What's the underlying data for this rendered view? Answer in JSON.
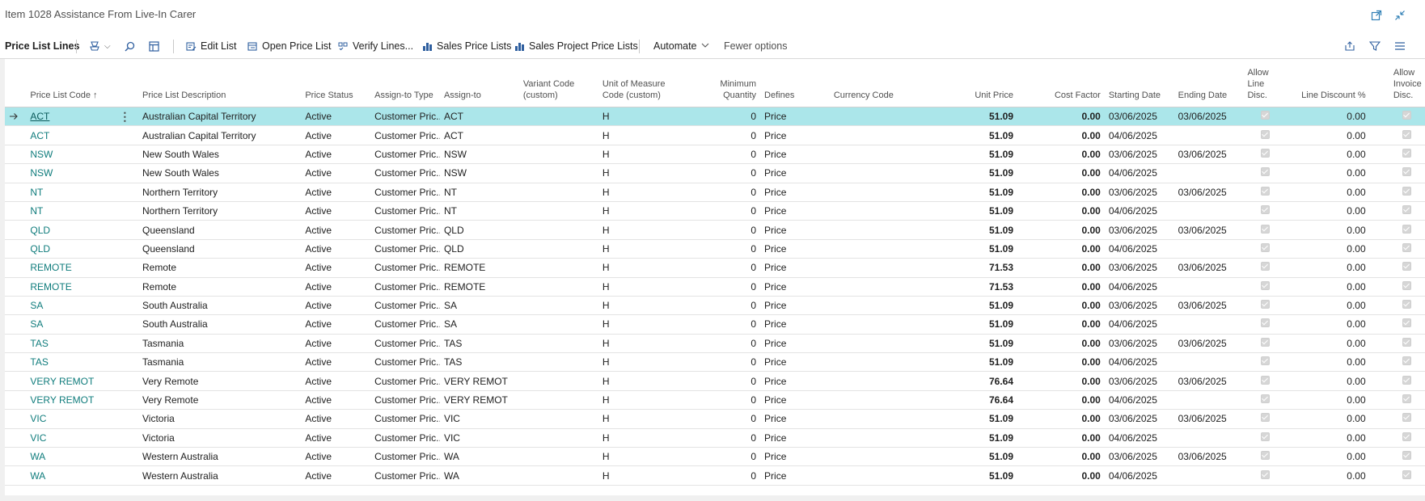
{
  "window": {
    "title": "Item 1028 Assistance From Live-In Carer"
  },
  "actionbar": {
    "section_title": "Price List Lines",
    "edit_list": "Edit List",
    "open_price_list": "Open Price List",
    "verify_lines": "Verify Lines...",
    "sales_price_lists": "Sales Price Lists",
    "sales_project_price_lists": "Sales Project Price Lists",
    "automate": "Automate",
    "fewer_options": "Fewer options"
  },
  "columns": {
    "price_list_code": "Price List Code",
    "sort_indicator": "↑",
    "price_list_description": "Price List Description",
    "price_status": "Price Status",
    "assign_to_type": "Assign-to Type",
    "assign_to": "Assign-to",
    "variant_code": "Variant Code (custom)",
    "unit_of_measure": "Unit of Measure Code (custom)",
    "minimum_quantity": "Minimum Quantity",
    "defines": "Defines",
    "currency_code": "Currency Code",
    "unit_price": "Unit Price",
    "cost_factor": "Cost Factor",
    "starting_date": "Starting Date",
    "ending_date": "Ending Date",
    "allow_line_disc": "Allow Line Disc.",
    "line_discount": "Line Discount %",
    "allow_invoice_disc": "Allow Invoice Disc."
  },
  "rows": [
    {
      "code": "ACT",
      "desc": "Australian Capital Territory",
      "status": "Active",
      "type": "Customer Pric...",
      "assign": "ACT",
      "variant": "",
      "uom": "H",
      "minqty": "0",
      "defines": "Price",
      "currency": "",
      "price": "51.09",
      "cost": "0.00",
      "start": "03/06/2025",
      "end": "03/06/2025",
      "linedisc": "0.00"
    },
    {
      "code": "ACT",
      "desc": "Australian Capital Territory",
      "status": "Active",
      "type": "Customer Pric...",
      "assign": "ACT",
      "variant": "",
      "uom": "H",
      "minqty": "0",
      "defines": "Price",
      "currency": "",
      "price": "51.09",
      "cost": "0.00",
      "start": "04/06/2025",
      "end": "",
      "linedisc": "0.00"
    },
    {
      "code": "NSW",
      "desc": "New South Wales",
      "status": "Active",
      "type": "Customer Pric...",
      "assign": "NSW",
      "variant": "",
      "uom": "H",
      "minqty": "0",
      "defines": "Price",
      "currency": "",
      "price": "51.09",
      "cost": "0.00",
      "start": "03/06/2025",
      "end": "03/06/2025",
      "linedisc": "0.00"
    },
    {
      "code": "NSW",
      "desc": "New South Wales",
      "status": "Active",
      "type": "Customer Pric...",
      "assign": "NSW",
      "variant": "",
      "uom": "H",
      "minqty": "0",
      "defines": "Price",
      "currency": "",
      "price": "51.09",
      "cost": "0.00",
      "start": "04/06/2025",
      "end": "",
      "linedisc": "0.00"
    },
    {
      "code": "NT",
      "desc": "Northern Territory",
      "status": "Active",
      "type": "Customer Pric...",
      "assign": "NT",
      "variant": "",
      "uom": "H",
      "minqty": "0",
      "defines": "Price",
      "currency": "",
      "price": "51.09",
      "cost": "0.00",
      "start": "03/06/2025",
      "end": "03/06/2025",
      "linedisc": "0.00"
    },
    {
      "code": "NT",
      "desc": "Northern Territory",
      "status": "Active",
      "type": "Customer Pric...",
      "assign": "NT",
      "variant": "",
      "uom": "H",
      "minqty": "0",
      "defines": "Price",
      "currency": "",
      "price": "51.09",
      "cost": "0.00",
      "start": "04/06/2025",
      "end": "",
      "linedisc": "0.00"
    },
    {
      "code": "QLD",
      "desc": "Queensland",
      "status": "Active",
      "type": "Customer Pric...",
      "assign": "QLD",
      "variant": "",
      "uom": "H",
      "minqty": "0",
      "defines": "Price",
      "currency": "",
      "price": "51.09",
      "cost": "0.00",
      "start": "03/06/2025",
      "end": "03/06/2025",
      "linedisc": "0.00"
    },
    {
      "code": "QLD",
      "desc": "Queensland",
      "status": "Active",
      "type": "Customer Pric...",
      "assign": "QLD",
      "variant": "",
      "uom": "H",
      "minqty": "0",
      "defines": "Price",
      "currency": "",
      "price": "51.09",
      "cost": "0.00",
      "start": "04/06/2025",
      "end": "",
      "linedisc": "0.00"
    },
    {
      "code": "REMOTE",
      "desc": "Remote",
      "status": "Active",
      "type": "Customer Pric...",
      "assign": "REMOTE",
      "variant": "",
      "uom": "H",
      "minqty": "0",
      "defines": "Price",
      "currency": "",
      "price": "71.53",
      "cost": "0.00",
      "start": "03/06/2025",
      "end": "03/06/2025",
      "linedisc": "0.00"
    },
    {
      "code": "REMOTE",
      "desc": "Remote",
      "status": "Active",
      "type": "Customer Pric...",
      "assign": "REMOTE",
      "variant": "",
      "uom": "H",
      "minqty": "0",
      "defines": "Price",
      "currency": "",
      "price": "71.53",
      "cost": "0.00",
      "start": "04/06/2025",
      "end": "",
      "linedisc": "0.00"
    },
    {
      "code": "SA",
      "desc": "South Australia",
      "status": "Active",
      "type": "Customer Pric...",
      "assign": "SA",
      "variant": "",
      "uom": "H",
      "minqty": "0",
      "defines": "Price",
      "currency": "",
      "price": "51.09",
      "cost": "0.00",
      "start": "03/06/2025",
      "end": "03/06/2025",
      "linedisc": "0.00"
    },
    {
      "code": "SA",
      "desc": "South Australia",
      "status": "Active",
      "type": "Customer Pric...",
      "assign": "SA",
      "variant": "",
      "uom": "H",
      "minqty": "0",
      "defines": "Price",
      "currency": "",
      "price": "51.09",
      "cost": "0.00",
      "start": "04/06/2025",
      "end": "",
      "linedisc": "0.00"
    },
    {
      "code": "TAS",
      "desc": "Tasmania",
      "status": "Active",
      "type": "Customer Pric...",
      "assign": "TAS",
      "variant": "",
      "uom": "H",
      "minqty": "0",
      "defines": "Price",
      "currency": "",
      "price": "51.09",
      "cost": "0.00",
      "start": "03/06/2025",
      "end": "03/06/2025",
      "linedisc": "0.00"
    },
    {
      "code": "TAS",
      "desc": "Tasmania",
      "status": "Active",
      "type": "Customer Pric...",
      "assign": "TAS",
      "variant": "",
      "uom": "H",
      "minqty": "0",
      "defines": "Price",
      "currency": "",
      "price": "51.09",
      "cost": "0.00",
      "start": "04/06/2025",
      "end": "",
      "linedisc": "0.00"
    },
    {
      "code": "VERY REMOT",
      "desc": "Very Remote",
      "status": "Active",
      "type": "Customer Pric...",
      "assign": "VERY REMOT",
      "variant": "",
      "uom": "H",
      "minqty": "0",
      "defines": "Price",
      "currency": "",
      "price": "76.64",
      "cost": "0.00",
      "start": "03/06/2025",
      "end": "03/06/2025",
      "linedisc": "0.00"
    },
    {
      "code": "VERY REMOT",
      "desc": "Very Remote",
      "status": "Active",
      "type": "Customer Pric...",
      "assign": "VERY REMOT",
      "variant": "",
      "uom": "H",
      "minqty": "0",
      "defines": "Price",
      "currency": "",
      "price": "76.64",
      "cost": "0.00",
      "start": "04/06/2025",
      "end": "",
      "linedisc": "0.00"
    },
    {
      "code": "VIC",
      "desc": "Victoria",
      "status": "Active",
      "type": "Customer Pric...",
      "assign": "VIC",
      "variant": "",
      "uom": "H",
      "minqty": "0",
      "defines": "Price",
      "currency": "",
      "price": "51.09",
      "cost": "0.00",
      "start": "03/06/2025",
      "end": "03/06/2025",
      "linedisc": "0.00"
    },
    {
      "code": "VIC",
      "desc": "Victoria",
      "status": "Active",
      "type": "Customer Pric...",
      "assign": "VIC",
      "variant": "",
      "uom": "H",
      "minqty": "0",
      "defines": "Price",
      "currency": "",
      "price": "51.09",
      "cost": "0.00",
      "start": "04/06/2025",
      "end": "",
      "linedisc": "0.00"
    },
    {
      "code": "WA",
      "desc": "Western Australia",
      "status": "Active",
      "type": "Customer Pric...",
      "assign": "WA",
      "variant": "",
      "uom": "H",
      "minqty": "0",
      "defines": "Price",
      "currency": "",
      "price": "51.09",
      "cost": "0.00",
      "start": "03/06/2025",
      "end": "03/06/2025",
      "linedisc": "0.00"
    },
    {
      "code": "WA",
      "desc": "Western Australia",
      "status": "Active",
      "type": "Customer Pric...",
      "assign": "WA",
      "variant": "",
      "uom": "H",
      "minqty": "0",
      "defines": "Price",
      "currency": "",
      "price": "51.09",
      "cost": "0.00",
      "start": "04/06/2025",
      "end": "",
      "linedisc": "0.00"
    }
  ],
  "selected_row": 0,
  "colors": {
    "accent_link": "#0f7c7c",
    "selected_row": "#abe6ea"
  }
}
